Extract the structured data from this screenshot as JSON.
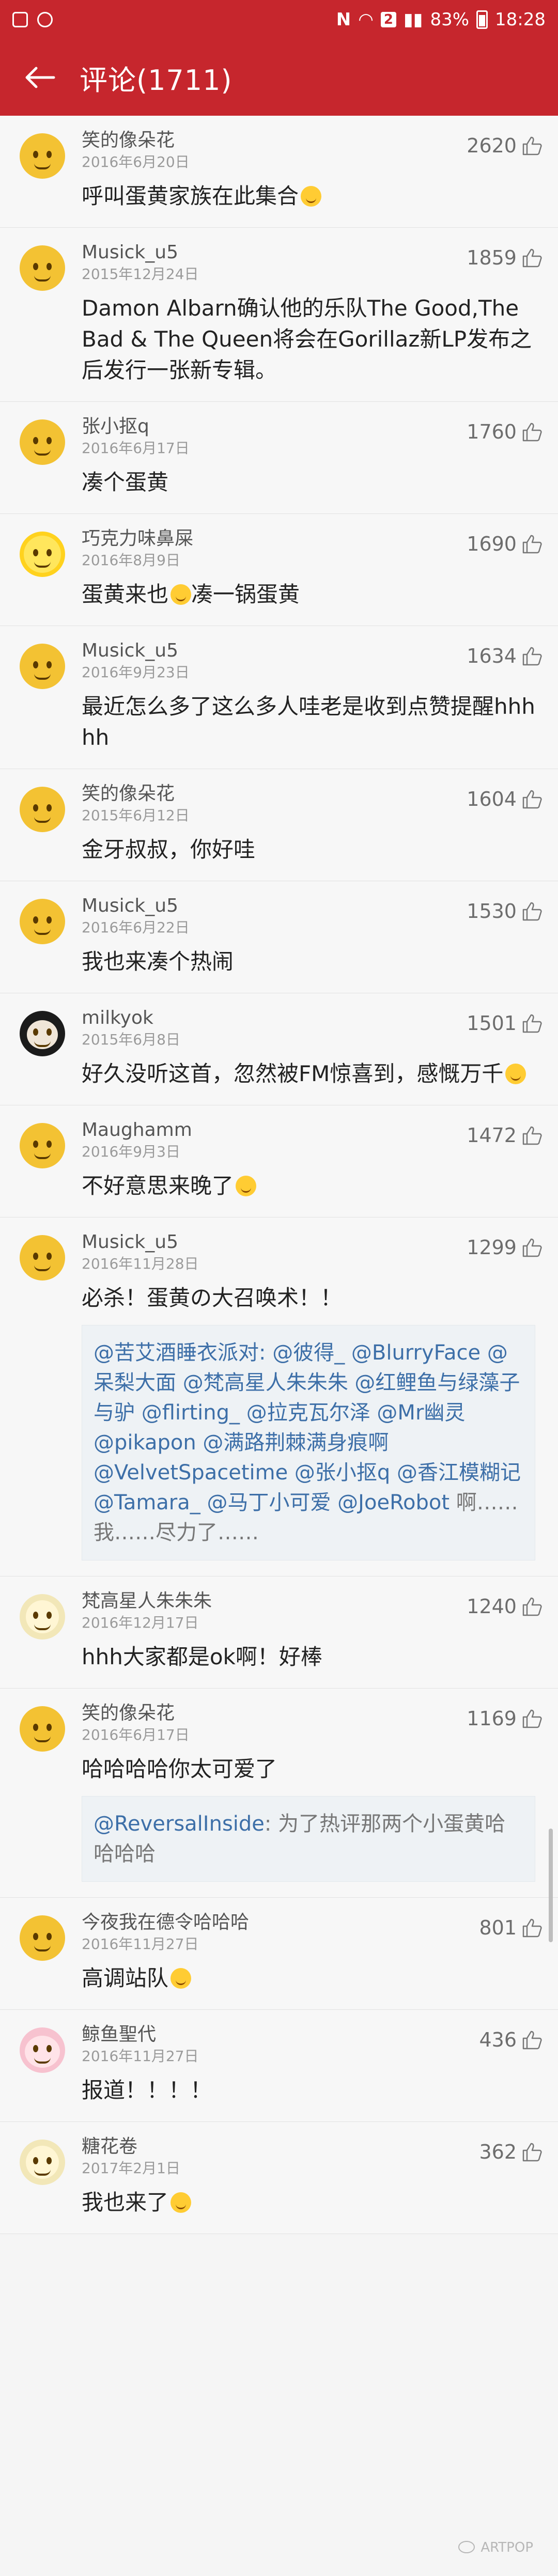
{
  "status": {
    "battery": "83%",
    "time": "18:28",
    "badge": "2"
  },
  "header": {
    "title": "评论(1711)"
  },
  "comments": [
    {
      "user": "笑的像朵花",
      "date": "2016年6月20日",
      "likes": "2620",
      "text": "呼叫蛋黄家族在此集合"
    },
    {
      "user": "Musick_u5",
      "date": "2015年12月24日",
      "likes": "1859",
      "text": "Damon Albarn确认他的乐队The Good,The Bad & The Queen将会在Gorillaz新LP发布之后发行一张新专辑。"
    },
    {
      "user": "张小抠q",
      "date": "2016年6月17日",
      "likes": "1760",
      "text": "凑个蛋黄"
    },
    {
      "user": "巧克力味鼻屎",
      "date": "2016年8月9日",
      "likes": "1690",
      "text": "蛋黄来也",
      "text2": "凑一锅蛋黄"
    },
    {
      "user": "Musick_u5",
      "date": "2016年9月23日",
      "likes": "1634",
      "text": "最近怎么多了这么多人哇老是收到点赞提醒hhhhh"
    },
    {
      "user": "笑的像朵花",
      "date": "2015年6月12日",
      "likes": "1604",
      "text": "金牙叔叔，你好哇"
    },
    {
      "user": "Musick_u5",
      "date": "2016年6月22日",
      "likes": "1530",
      "text": "我也来凑个热闹"
    },
    {
      "user": "milkyok",
      "date": "2015年6月8日",
      "likes": "1501",
      "text": "好久没听这首，忽然被FM惊喜到，感慨万千"
    },
    {
      "user": "Maughamm",
      "date": "2016年9月3日",
      "likes": "1472",
      "text": "不好意思来晚了"
    },
    {
      "user": "Musick_u5",
      "date": "2016年11月28日",
      "likes": "1299",
      "text": "必杀！蛋黄の大召唤术！！",
      "quote": {
        "mentions": "@苦艾酒睡衣派对: @彼得_ @BlurryFace @呆梨大面 @梵高星人朱朱朱 @红鲤鱼与绿藻子与驴 @flirting_ @拉克瓦尔泽 @Mr幽灵 @pikapon @满路荆棘满身痕啊 @VelvetSpacetime @张小抠q @香江模糊记 @Tamara_ @马丁小可爱 @JoeRobot",
        "tail": " 啊……我……尽力了……"
      }
    },
    {
      "user": "梵高星人朱朱朱",
      "date": "2016年12月17日",
      "likes": "1240",
      "text": "hhh大家都是ok啊！好棒"
    },
    {
      "user": "笑的像朵花",
      "date": "2016年6月17日",
      "likes": "1169",
      "text": "哈哈哈哈你太可爱了",
      "quote": {
        "mentions": "@ReversalInside",
        "tail": ": 为了热评那两个小蛋黄哈哈哈哈"
      }
    },
    {
      "user": "今夜我在德令哈哈哈",
      "date": "2016年11月27日",
      "likes": "801",
      "text": "高调站队"
    },
    {
      "user": "鲸鱼聖代",
      "date": "2016年11月27日",
      "likes": "436",
      "text": "报道！！！！"
    },
    {
      "user": "糖花卷",
      "date": "2017年2月1日",
      "likes": "362",
      "text": "我也来了"
    }
  ],
  "watermark": "ARTPOP"
}
